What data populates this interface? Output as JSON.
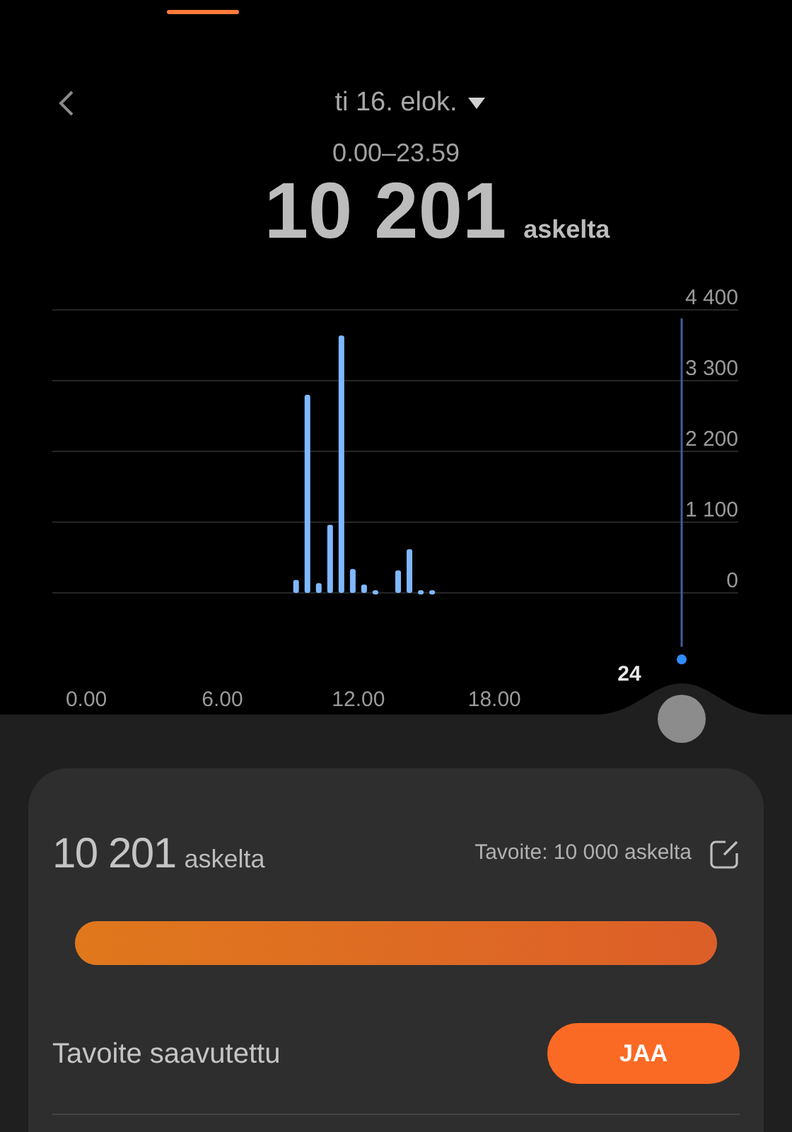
{
  "header": {
    "date": "ti 16. elok.",
    "range": "0.00–23.59",
    "total": "10 201",
    "unit": "askelta"
  },
  "chart_data": {
    "type": "bar",
    "x": [
      9.25,
      9.75,
      10.25,
      10.75,
      11.25,
      11.75,
      12.25,
      12.75,
      13.75,
      14.25,
      14.75,
      15.25
    ],
    "series": [
      {
        "color": "#7fb8ff",
        "values": [
          200,
          3080,
          150,
          1060,
          4000,
          370,
          130,
          40,
          350,
          680,
          40,
          40
        ]
      }
    ],
    "xlim": [
      -1.5,
      28.75
    ],
    "ylim": [
      0,
      4400
    ],
    "grid": true,
    "xticks": [
      {
        "value": 0,
        "label": "0.00"
      },
      {
        "value": 6,
        "label": "6.00"
      },
      {
        "value": 12,
        "label": "12.00"
      },
      {
        "value": 18,
        "label": "18.00"
      }
    ],
    "yticks": [
      {
        "value": 0,
        "label": "0"
      },
      {
        "value": 1100,
        "label": "1 100"
      },
      {
        "value": 2200,
        "label": "2 200"
      },
      {
        "value": 3300,
        "label": "3 300"
      },
      {
        "value": 4400,
        "label": "4 400"
      }
    ]
  },
  "cursor_label": "24",
  "card": {
    "total": "10 201",
    "unit": "askelta",
    "goal": "Tavoite: 10 000 askelta",
    "level": 1,
    "status": "Tavoite saavutettu",
    "share_button": "JAA"
  }
}
